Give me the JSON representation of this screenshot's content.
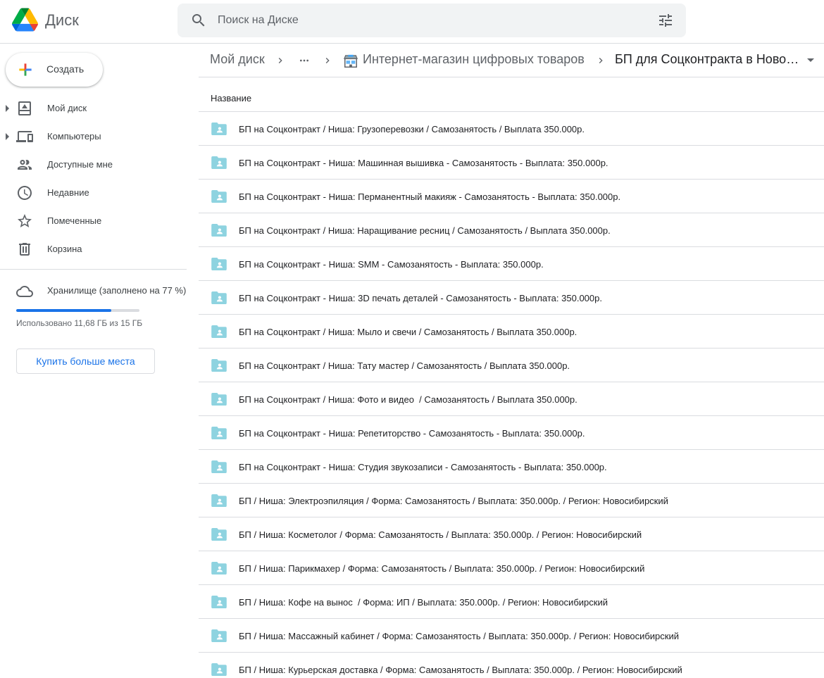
{
  "header": {
    "app_name": "Диск",
    "search_placeholder": "Поиск на Диске"
  },
  "sidebar": {
    "create_label": "Создать",
    "items": [
      {
        "label": "Мой диск",
        "icon": "drive-icon",
        "expandable": true
      },
      {
        "label": "Компьютеры",
        "icon": "computers-icon",
        "expandable": true
      },
      {
        "label": "Доступные мне",
        "icon": "shared-icon",
        "expandable": false
      },
      {
        "label": "Недавние",
        "icon": "clock-icon",
        "expandable": false
      },
      {
        "label": "Помеченные",
        "icon": "star-icon",
        "expandable": false
      },
      {
        "label": "Корзина",
        "icon": "trash-icon",
        "expandable": false
      }
    ],
    "storage": {
      "title": "Хранилище (заполнено на 77 %)",
      "used_fraction": 0.77,
      "used_text": "Использовано 11,68 ГБ из 15 ГБ",
      "buy_label": "Купить больше места"
    }
  },
  "breadcrumb": {
    "root": "Мой диск",
    "parent": "Интернет-магазин цифровых товаров",
    "current": "БП для Соцконтракта в Новосибирске"
  },
  "table": {
    "column_name": "Название",
    "rows": [
      "БП на Соцконтракт / Ниша: Грузоперевозки / Самозанятость / Выплата 350.000р.",
      "БП на Соцконтракт - Ниша: Машинная вышивка - Самозанятость - Выплата: 350.000р.",
      "БП на Соцконтракт - Ниша: Перманентный макияж - Самозанятость - Выплата: 350.000р.",
      "БП на Соцконтракт / Ниша: Наращивание ресниц / Самозанятость / Выплата 350.000р.",
      "БП на Соцконтракт - Ниша: SMM - Самозанятость - Выплата: 350.000р.",
      "БП на Соцконтракт - Ниша: 3D печать деталей - Самозанятость - Выплата: 350.000р.",
      "БП на Соцконтракт / Ниша: Мыло и свечи / Самозанятость / Выплата 350.000р.",
      "БП на Соцконтракт / Ниша: Тату мастер / Самозанятость / Выплата 350.000р.",
      "БП на Соцконтракт / Ниша: Фото и видео  / Самозанятость / Выплата 350.000р.",
      "БП на Соцконтракт - Ниша: Репетиторство - Самозанятость - Выплата: 350.000р.",
      "БП на Соцконтракт - Ниша: Студия звукозаписи - Самозанятость - Выплата: 350.000р.",
      "БП / Ниша: Электроэпиляция / Форма: Самозанятость / Выплата: 350.000р. / Регион: Новосибирский",
      "БП / Ниша: Косметолог / Форма: Самозанятость / Выплата: 350.000р. / Регион: Новосибирский",
      "БП / Ниша: Парикмахер / Форма: Самозанятость / Выплата: 350.000р. / Регион: Новосибирский",
      "БП / Ниша: Кофе на вынос  / Форма: ИП / Выплата: 350.000р. / Регион: Новосибирский",
      "БП / Ниша: Массажный кабинет / Форма: Самозанятость / Выплата: 350.000р. / Регион: Новосибирский",
      "БП / Ниша: Курьерская доставка / Форма: Самозанятость / Выплата: 350.000р. / Регион: Новосибирский"
    ]
  }
}
